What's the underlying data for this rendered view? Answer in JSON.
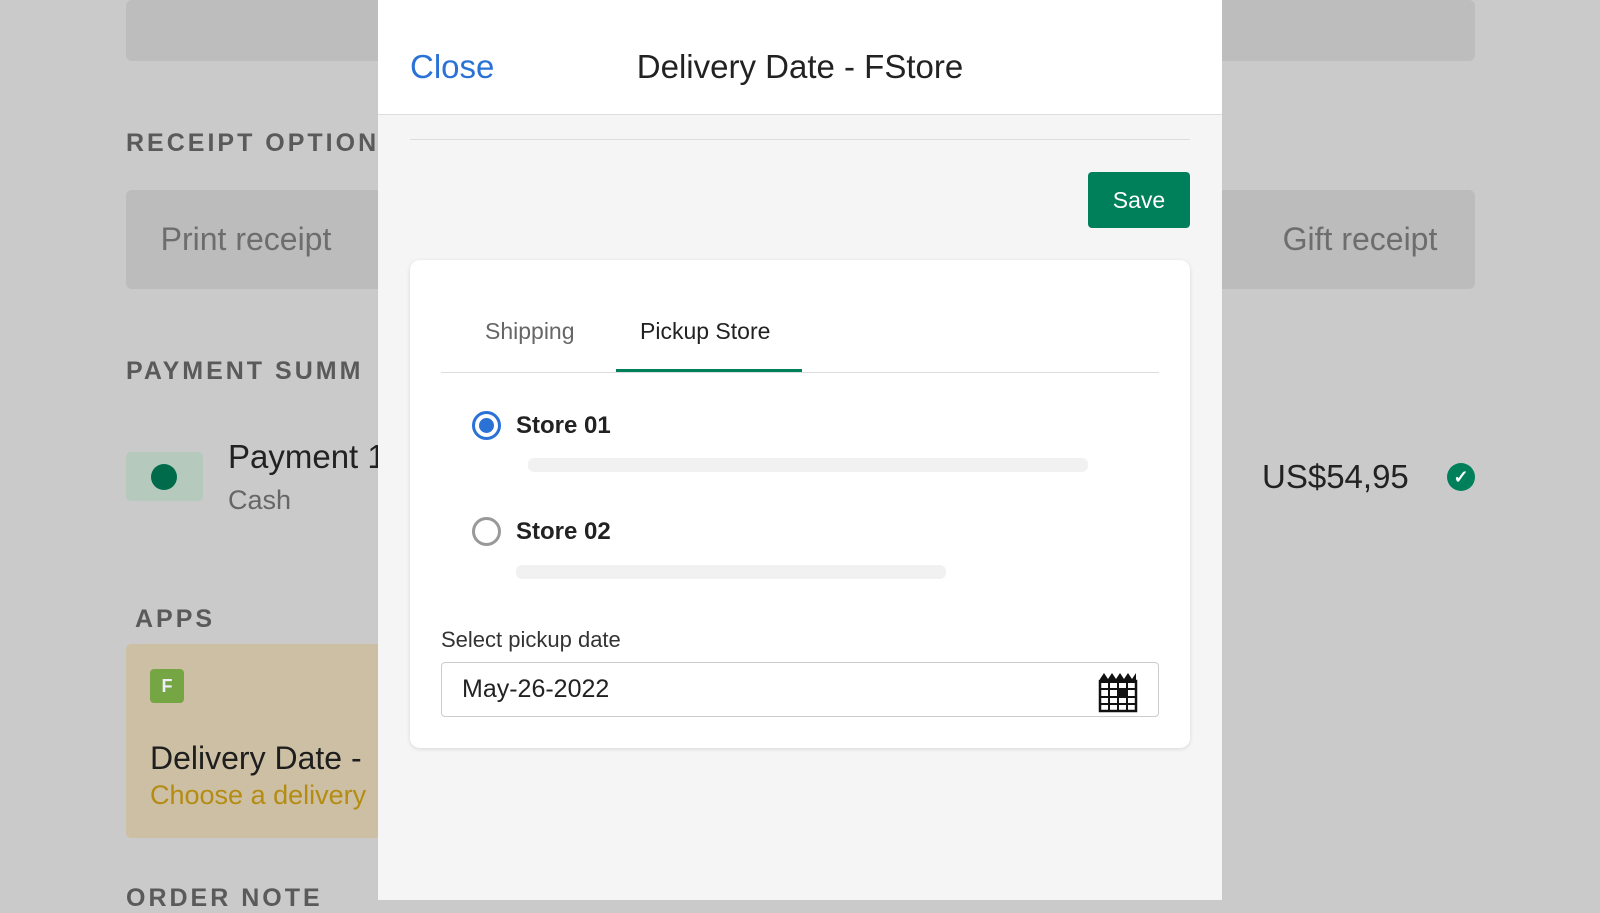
{
  "background": {
    "receipt_heading": "RECEIPT OPTION",
    "print_receipt": "Print receipt",
    "gift_receipt": "Gift receipt",
    "payment_heading": "PAYMENT SUMM",
    "payment_name": "Payment 1",
    "payment_method": "Cash",
    "amount": "US$54,95",
    "apps_heading": "APPS",
    "app_logo_letter": "F",
    "app_title": "Delivery Date - ",
    "app_subtitle": "Choose a delivery",
    "order_note_heading": "ORDER NOTE"
  },
  "modal": {
    "close_label": "Close",
    "title": "Delivery Date - FStore",
    "save_label": "Save",
    "tabs": [
      {
        "label": "Shipping",
        "active": false
      },
      {
        "label": "Pickup Store",
        "active": true
      }
    ],
    "stores": [
      {
        "name": "Store 01",
        "selected": true
      },
      {
        "name": "Store 02",
        "selected": false
      }
    ],
    "date_label": "Select pickup date",
    "date_value": "May-26-2022"
  },
  "colors": {
    "accent": "#00805a",
    "link": "#2b72d6"
  }
}
